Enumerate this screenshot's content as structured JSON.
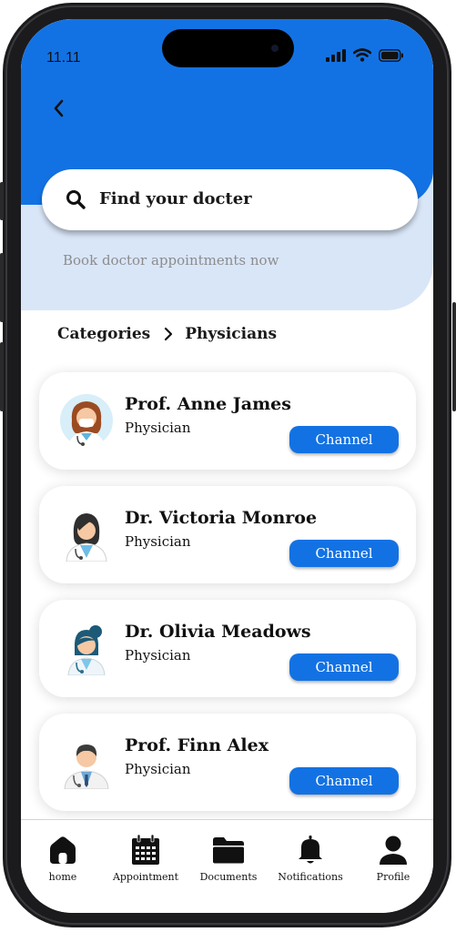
{
  "status_bar": {
    "time": "11.11"
  },
  "header": {
    "back_icon": "chevron-left-icon"
  },
  "search": {
    "placeholder": "Find your docter",
    "icon": "search-icon"
  },
  "subtitle": "Book doctor appointments now",
  "breadcrumb": {
    "root": "Categories",
    "current": "Physicians"
  },
  "doctors": [
    {
      "name": "Prof. Anne James",
      "role": "Physician",
      "action": "Channel"
    },
    {
      "name": "Dr. Victoria Monroe",
      "role": "Physician",
      "action": "Channel"
    },
    {
      "name": "Dr. Olivia Meadows",
      "role": "Physician",
      "action": "Channel"
    },
    {
      "name": "Prof. Finn Alex",
      "role": "Physician",
      "action": "Channel"
    }
  ],
  "bottom_nav": [
    {
      "label": "home",
      "icon": "home-icon"
    },
    {
      "label": "Appointment",
      "icon": "calendar-icon"
    },
    {
      "label": "Documents",
      "icon": "folder-icon"
    },
    {
      "label": "Notifications",
      "icon": "bell-icon"
    },
    {
      "label": "Profile",
      "icon": "person-icon"
    }
  ],
  "colors": {
    "primary": "#1372e3",
    "hero_light": "#d9e6f8",
    "text": "#111111",
    "muted": "#8c8c8c"
  }
}
